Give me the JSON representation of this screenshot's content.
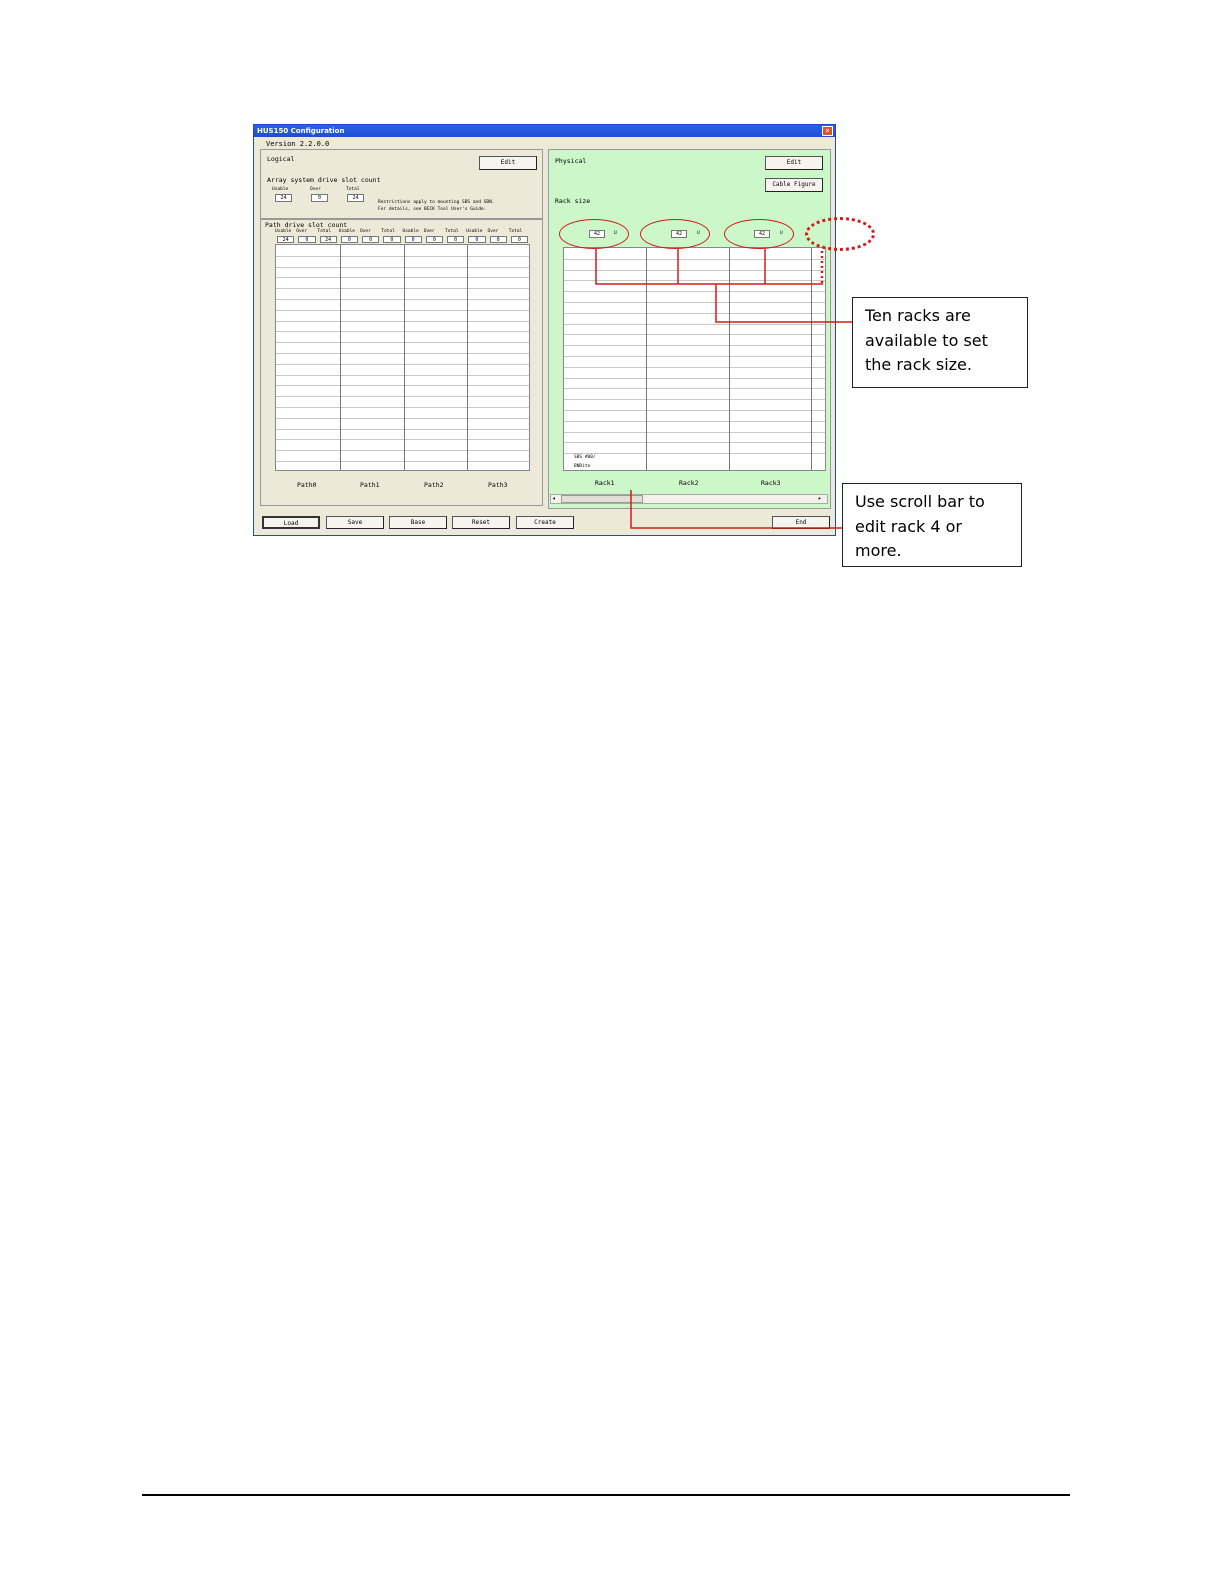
{
  "window": {
    "title": "HUS150 Configuration",
    "close_glyph": "×",
    "version_label": "Version",
    "version": "2.2.0.0"
  },
  "logical": {
    "title": "Logical",
    "edit_label": "Edit",
    "array_title": "Array system drive slot count",
    "usable_header": "Usable",
    "over_header": "Over",
    "total_header": "Total",
    "usable": "24",
    "over": "0",
    "total": "24",
    "restriction_line1": "Restrictions apply to mounting SBS and SBN.",
    "restriction_line2": "For details, see BECK Tool User's Guide."
  },
  "path": {
    "title": "Path drive slot count",
    "headers": [
      "Usable",
      "Over",
      "Total",
      "Usable",
      "Over",
      "Total",
      "Usable",
      "Over",
      "Total",
      "Usable",
      "Over",
      "Total"
    ],
    "values": [
      "24",
      "0",
      "24",
      "0",
      "0",
      "0",
      "0",
      "0",
      "0",
      "0",
      "0",
      "0"
    ],
    "labels": [
      "Path0",
      "Path1",
      "Path2",
      "Path3"
    ]
  },
  "physical": {
    "title": "Physical",
    "edit_label": "Edit",
    "cable_figure_label": "Cable Figure",
    "rack_size_label": "Rack size",
    "racks": [
      {
        "label": "Rack1",
        "size": "42",
        "unit": "U"
      },
      {
        "label": "Rack2",
        "size": "42",
        "unit": "U"
      },
      {
        "label": "Rack3",
        "size": "42",
        "unit": "U"
      }
    ],
    "grid_footer_1": "SBS    #00/",
    "grid_footer_2": "BNRite"
  },
  "bottom_buttons": {
    "load": "Load",
    "save": "Save",
    "base": "Base",
    "reset": "Reset",
    "create": "Create",
    "end": "End"
  },
  "callouts": {
    "ten_racks": [
      "Ten racks are",
      "available to set",
      "the rack size."
    ],
    "scroll_bar": [
      "Use scroll bar to",
      "edit rack 4 or",
      "more."
    ]
  },
  "colors": {
    "highlight": "#d21c1c",
    "physical_bg": "#ccf7c8",
    "title_bar": "#2a63e6"
  }
}
